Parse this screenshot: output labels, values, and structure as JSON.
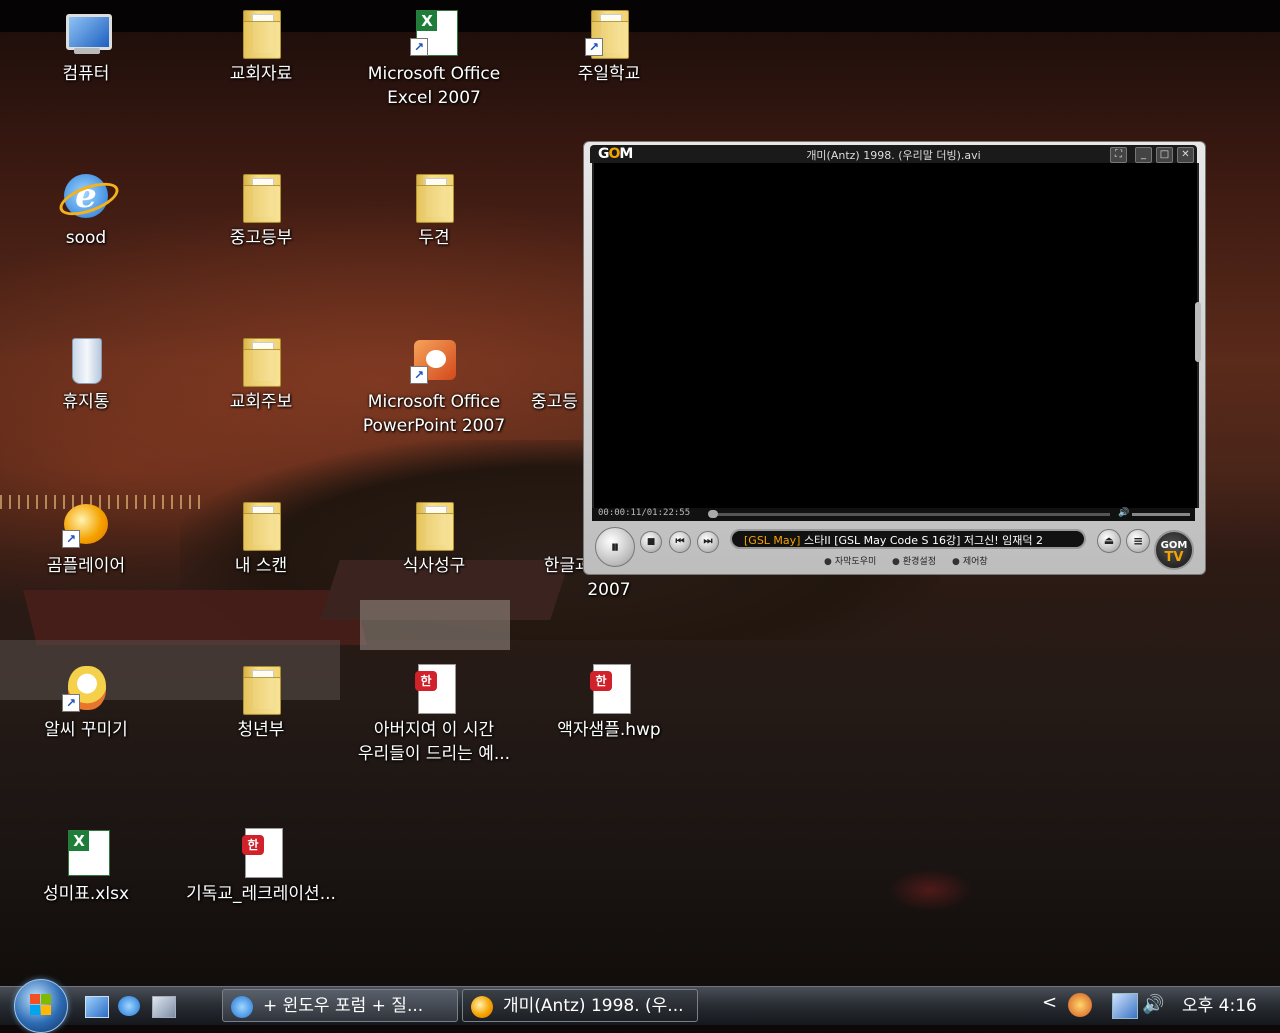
{
  "desktop": {
    "icons": [
      {
        "label": "컴퓨터"
      },
      {
        "label": "교회자료"
      },
      {
        "label": "Microsoft Office\nExcel 2007"
      },
      {
        "label": "주일학교"
      },
      {
        "label": "sood"
      },
      {
        "label": "중고등부"
      },
      {
        "label": "두견"
      },
      {
        "label": "휴지통"
      },
      {
        "label": "교회주보"
      },
      {
        "label": "Microsoft Office\nPowerPoint 2007"
      },
      {
        "label": "중고등"
      },
      {
        "label": "곰플레이어"
      },
      {
        "label": "내 스캔"
      },
      {
        "label": "식사성구"
      },
      {
        "label": "한글과컴퓨터 한글\n2007"
      },
      {
        "label": "알씨 꾸미기"
      },
      {
        "label": "청년부"
      },
      {
        "label": "아버지여 이 시간\n우리들이 드리는 예..."
      },
      {
        "label": "액자샘플.hwp"
      },
      {
        "label": "성미표.xlsx"
      },
      {
        "label": "기독교_레크레이션..."
      }
    ]
  },
  "player": {
    "logo_pre": "G",
    "logo_o": "O",
    "logo_post": "M",
    "title": "개미(Antz) 1998. (우리말 더빙).avi",
    "window_buttons": {
      "fullscreen": "⛶",
      "minimize": "_",
      "maximize": "□",
      "close": "✕"
    },
    "time": "00:00:11/01:22:55",
    "volume_icon": "🔊",
    "marquee_tag": "[GSL May]",
    "marquee_text": " 스타II [GSL May Code S 16강] 저그신! 임재덕 2",
    "play_label": "⏸",
    "stop_label": "■",
    "prev_label": "⏮",
    "next_label": "⏭",
    "eject_label": "⏏",
    "menu_label": "≡",
    "links": [
      "자막도우미",
      "환경설정",
      "제어창"
    ],
    "gomtv": {
      "line1": "GOM",
      "line2": "TV"
    }
  },
  "taskbar": {
    "tasks": [
      {
        "label": "+ 윈도우 포럼 + 질...",
        "icon": "ie-icon"
      },
      {
        "label": "개미(Antz) 1998. (우...",
        "icon": "gom-icon"
      }
    ],
    "tray_arrow": "<",
    "clock": "오후 4:16"
  },
  "colors": {
    "gom_accent": "#f5a300",
    "ie_blue": "#1e74d6"
  }
}
